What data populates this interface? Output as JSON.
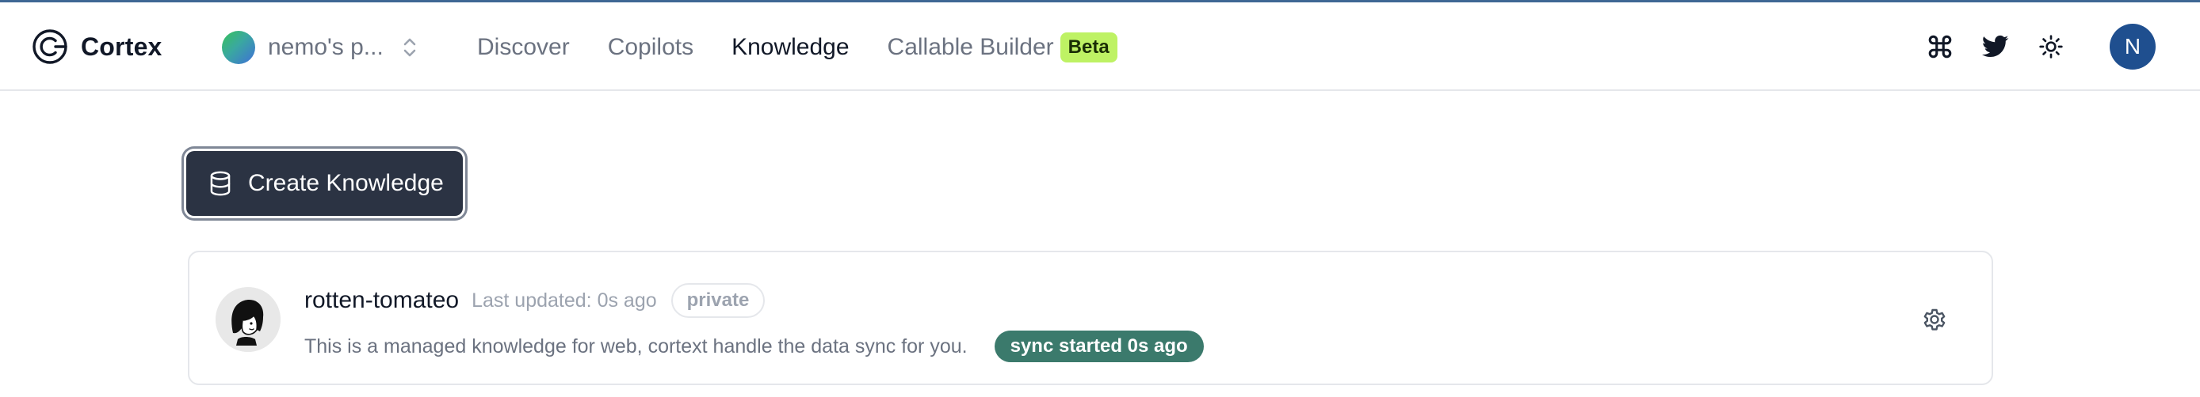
{
  "app": {
    "name": "Cortex",
    "logo_icon": "cortex-logo-icon"
  },
  "workspace": {
    "name": "nemo's p...",
    "avatar_icon": "gradient-circle",
    "switcher_icon": "chevron-up-down-icon"
  },
  "nav": {
    "links": [
      {
        "label": "Discover",
        "active": false
      },
      {
        "label": "Copilots",
        "active": false
      },
      {
        "label": "Knowledge",
        "active": true
      },
      {
        "label": "Callable Builder",
        "active": false,
        "badge": "Beta"
      }
    ]
  },
  "header_actions": {
    "icons": [
      "command-icon",
      "twitter-icon",
      "sun-icon"
    ],
    "user_initial": "N"
  },
  "main": {
    "create_button": {
      "label": "Create Knowledge",
      "icon": "database-icon"
    },
    "knowledge_items": [
      {
        "title": "rotten-tomateo",
        "updated": "Last updated: 0s ago",
        "visibility": "private",
        "description": "This is a managed knowledge for web, cortext handle the data sync for you.",
        "sync_status": "sync started 0s ago",
        "settings_icon": "gear-icon"
      }
    ]
  },
  "colors": {
    "primary_button": "#2b3343",
    "beta_badge": "#bef264",
    "sync_badge": "#3b7a6c",
    "avatar": "#1f4f8f",
    "top_accent": "#3f6794"
  }
}
